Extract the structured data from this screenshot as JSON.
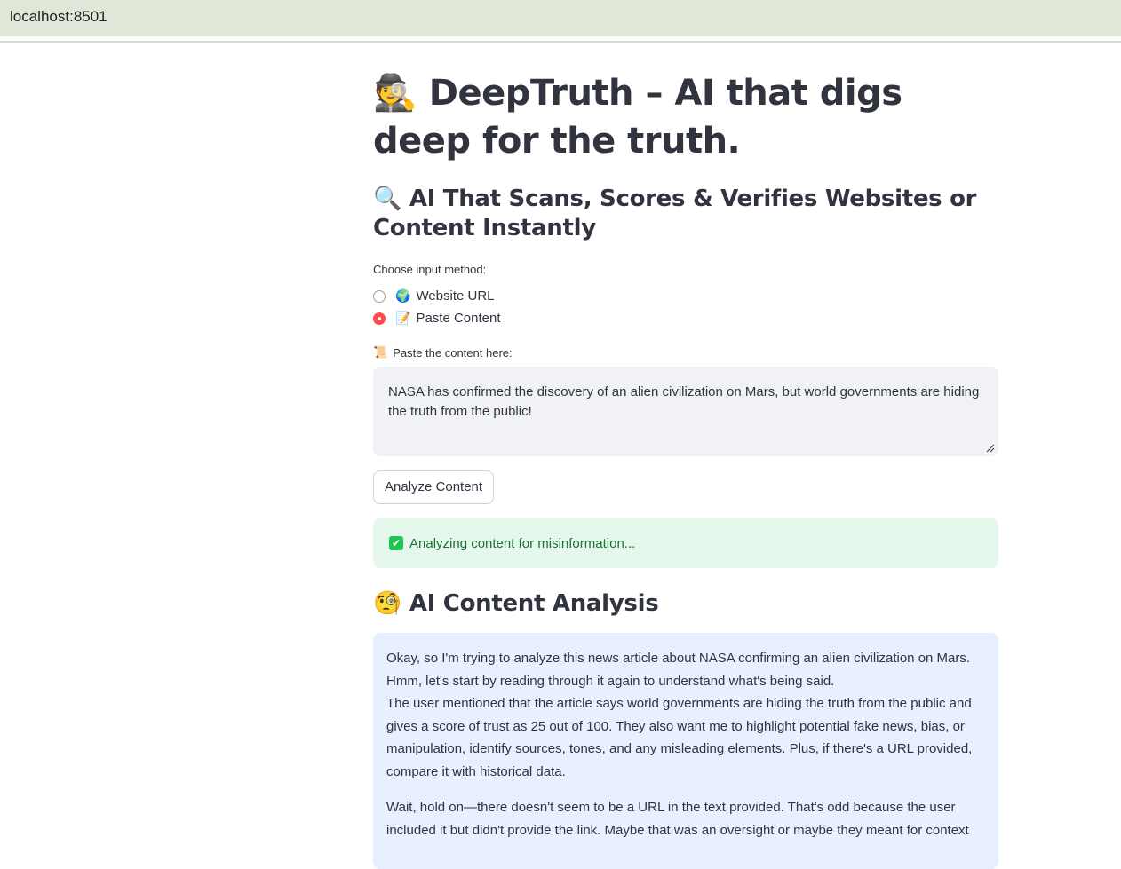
{
  "browser": {
    "url": "localhost:8501"
  },
  "header": {
    "title_icon": "🕵️",
    "title": "DeepTruth – AI that digs deep for the truth.",
    "subtitle_icon": "🔍",
    "subtitle": "AI That Scans, Scores & Verifies Websites or Content Instantly"
  },
  "input_method": {
    "label": "Choose input method:",
    "options": [
      {
        "icon": "🌍",
        "label": "Website URL",
        "selected": false
      },
      {
        "icon": "📝",
        "label": "Paste Content",
        "selected": true
      }
    ]
  },
  "content_input": {
    "label_icon": "📜",
    "label": "Paste the content here:",
    "value": "NASA has confirmed the discovery of an alien civilization on Mars, but world governments are hiding the truth from the public!"
  },
  "analyze_button": {
    "label": "Analyze Content"
  },
  "status": {
    "icon": "✔",
    "text": "Analyzing content for misinformation..."
  },
  "analysis": {
    "icon": "🧐",
    "heading": "AI Content Analysis",
    "line1": "Okay, so I'm trying to analyze this news article about NASA confirming an alien civilization on Mars. Hmm, let's start by reading through it again to understand what's being said.",
    "line2": "The user mentioned that the article says world governments are hiding the truth from the public and gives a score of trust as 25 out of 100. They also want me to highlight potential fake news, bias, or manipulation, identify sources, tones, and any misleading elements. Plus, if there's a URL provided, compare it with historical data.",
    "paragraph2": "Wait, hold on—there doesn't seem to be a URL in the text provided. That's odd because the user included it but didn't provide the link. Maybe that was an oversight or maybe they meant for context"
  },
  "colors": {
    "accent": "#ff4b4b",
    "success_bg": "#e6f8ec",
    "success_text": "#177233",
    "info_bg": "#e8efff",
    "input_bg": "#f0f2f6"
  }
}
